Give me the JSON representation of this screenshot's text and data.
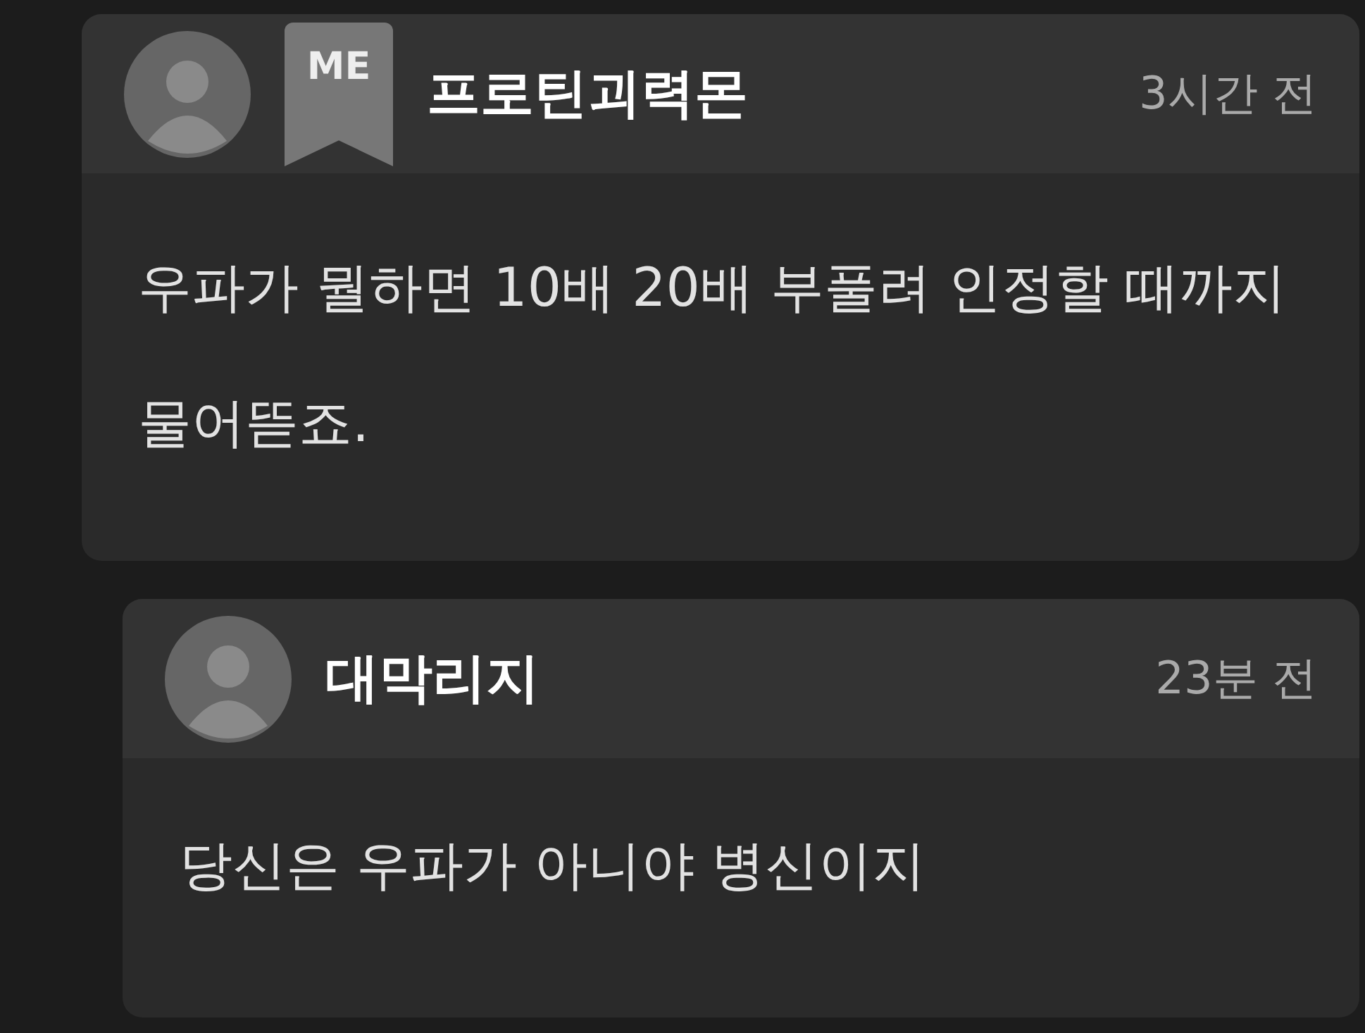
{
  "comments": [
    {
      "author": "프로틴괴력몬",
      "badge": "ME",
      "time": "3시간 전",
      "text": "우파가 뭘하면 10배 20배 부풀려 인정할 때까지 물어뜯죠.",
      "children": [
        {
          "author": "대막리지",
          "time": "23분 전",
          "text": "당신은 우파가 아니야 병신이지"
        }
      ]
    }
  ]
}
